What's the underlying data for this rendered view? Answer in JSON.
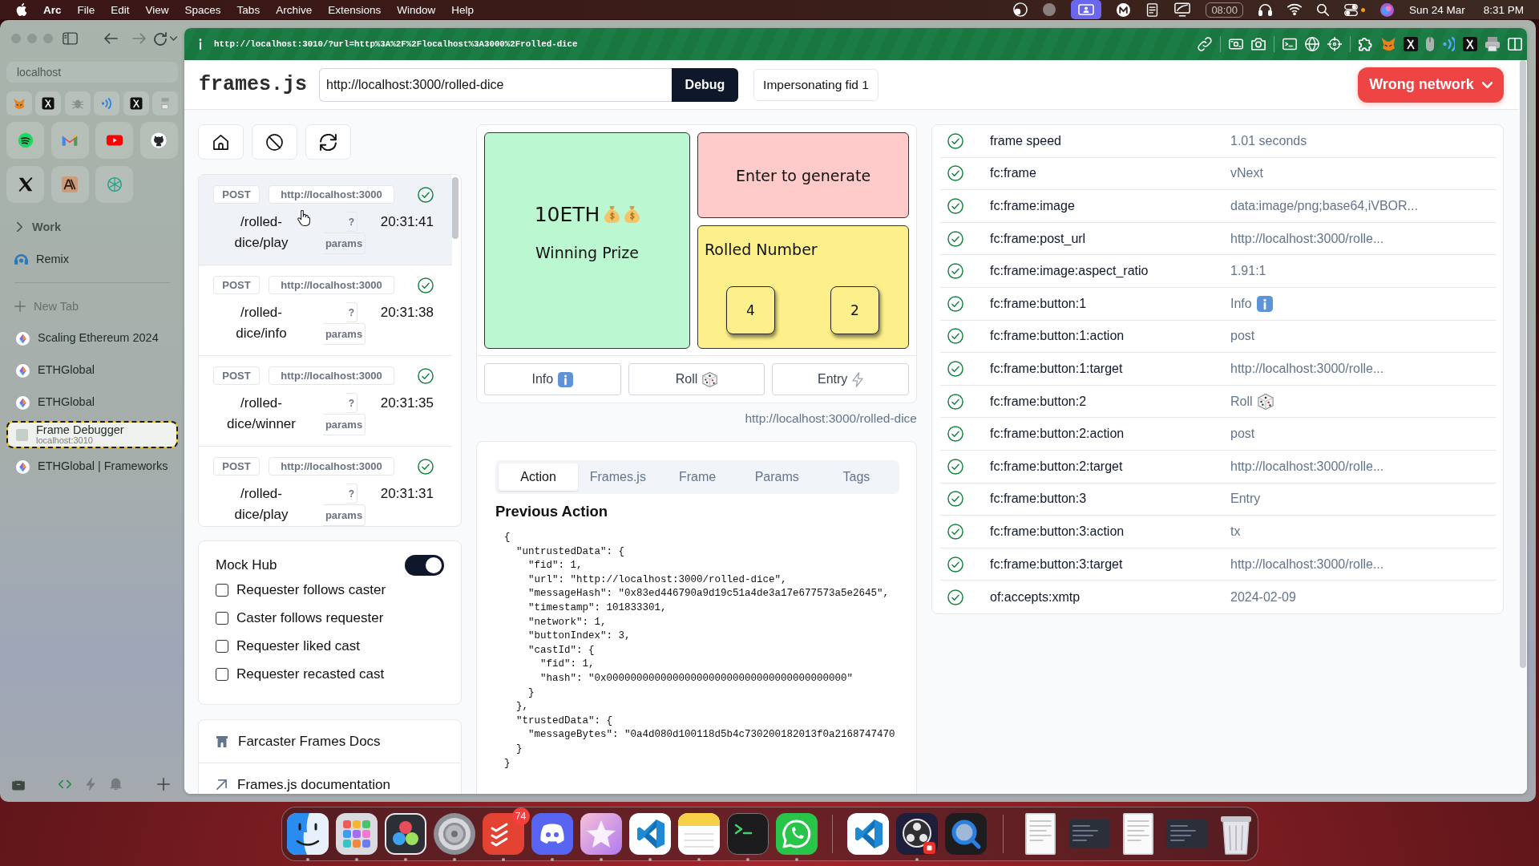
{
  "menu_bar": {
    "app": "Arc",
    "menus": [
      "File",
      "Edit",
      "View",
      "Spaces",
      "Tabs",
      "Archive",
      "Extensions",
      "Window",
      "Help"
    ],
    "timer": "08:00",
    "date": "Sun 24 Mar",
    "time": "8:31 PM"
  },
  "browser": {
    "address": "http://localhost:3010/?url=http%3A%2F%2Flocalhost%3A3000%2Frolled-dice"
  },
  "sidebar": {
    "search": "localhost",
    "folder": {
      "label": "Work",
      "expanded": false
    },
    "pinned_tab": "Remix",
    "new_tab": "New Tab",
    "tabs": [
      {
        "title": "Scaling Ethereum 2024",
        "kind": "page",
        "selected": false
      },
      {
        "title": "ETHGlobal",
        "kind": "page",
        "selected": false
      },
      {
        "title": "ETHGlobal",
        "kind": "page",
        "selected": false
      },
      {
        "title": "Frame Debugger",
        "subtitle": "localhost:3010",
        "kind": "local",
        "selected": true
      },
      {
        "title": "ETHGlobal | Frameworks",
        "kind": "page",
        "selected": false
      }
    ]
  },
  "page": {
    "header": {
      "logo": "frames.js",
      "url": "http://localhost:3000/rolled-dice",
      "debug": "Debug",
      "impersonation": "Impersonating fid 1",
      "network": "Wrong network"
    },
    "requests": [
      {
        "method": "POST",
        "host": "http://localhost:3000",
        "path": "/rolled-dice/play",
        "help": "?",
        "params": "params",
        "time": "20:31:41",
        "ok": true,
        "selected": true
      },
      {
        "method": "POST",
        "host": "http://localhost:3000",
        "path": "/rolled-dice/info",
        "help": "?",
        "params": "params",
        "time": "20:31:38",
        "ok": true,
        "selected": false
      },
      {
        "method": "POST",
        "host": "http://localhost:3000",
        "path": "/rolled-dice/winner",
        "help": "?",
        "params": "params",
        "time": "20:31:35",
        "ok": true,
        "selected": false
      },
      {
        "method": "POST",
        "host": "http://localhost:3000",
        "path": "/rolled-dice/play",
        "help": "?",
        "params": "params",
        "time": "20:31:31",
        "ok": true,
        "selected": false
      }
    ],
    "mock_hub": {
      "title": "Mock Hub",
      "on": true,
      "options": [
        {
          "label": "Requester follows caster",
          "checked": false
        },
        {
          "label": "Caster follows requester",
          "checked": false
        },
        {
          "label": "Requester liked cast",
          "checked": false
        },
        {
          "label": "Requester recasted cast",
          "checked": false
        }
      ]
    },
    "links": [
      {
        "label": "Farcaster Frames Docs",
        "kind": "docs"
      },
      {
        "label": "Frames.js documentation",
        "kind": "external"
      }
    ],
    "frame": {
      "prize": "10ETH",
      "prize_label": "Winning Prize",
      "prompt": "Enter to generate",
      "rolled_title": "Rolled Number",
      "dice": [
        "4",
        "2"
      ],
      "buttons": [
        {
          "label": "Info",
          "kind": "info"
        },
        {
          "label": "Roll",
          "kind": "dice"
        },
        {
          "label": "Entry",
          "kind": "bolt"
        }
      ],
      "url": "http://localhost:3000/rolled-dice"
    },
    "inspector": {
      "tabs": [
        {
          "label": "Action",
          "selected": true
        },
        {
          "label": "Frames.js",
          "selected": false
        },
        {
          "label": "Frame",
          "selected": false
        },
        {
          "label": "Params",
          "selected": false
        },
        {
          "label": "Tags",
          "selected": false
        }
      ],
      "title": "Previous Action",
      "code": "{\n  \"untrustedData\": {\n    \"fid\": 1,\n    \"url\": \"http://localhost:3000/rolled-dice\",\n    \"messageHash\": \"0x83ed446790a9d19c51a4de3a17e677573a5e2645\",\n    \"timestamp\": 101833301,\n    \"network\": 1,\n    \"buttonIndex\": 3,\n    \"castId\": {\n      \"fid\": 1,\n      \"hash\": \"0x0000000000000000000000000000000000000000\"\n    }\n  },\n  \"trustedData\": {\n    \"messageBytes\": \"0a4d080d100118d5b4c730200182013f0a2168747470\n  }\n}"
    },
    "properties": [
      {
        "name": "frame speed",
        "value": "1.01 seconds",
        "kind": "text",
        "ok": true
      },
      {
        "name": "fc:frame",
        "value": "vNext",
        "kind": "text",
        "ok": true
      },
      {
        "name": "fc:frame:image",
        "value": "data:image/png;base64,iVBOR...",
        "kind": "text",
        "ok": true
      },
      {
        "name": "fc:frame:post_url",
        "value": "http://localhost:3000/rolle...",
        "kind": "text",
        "ok": true
      },
      {
        "name": "fc:frame:image:aspect_ratio",
        "value": "1.91:1",
        "kind": "text",
        "ok": true
      },
      {
        "name": "fc:frame:button:1",
        "value": "Info",
        "kind": "info",
        "ok": true
      },
      {
        "name": "fc:frame:button:1:action",
        "value": "post",
        "kind": "text",
        "ok": true
      },
      {
        "name": "fc:frame:button:1:target",
        "value": "http://localhost:3000/rolle...",
        "kind": "text",
        "ok": true
      },
      {
        "name": "fc:frame:button:2",
        "value": "Roll",
        "kind": "dice",
        "ok": true
      },
      {
        "name": "fc:frame:button:2:action",
        "value": "post",
        "kind": "text",
        "ok": true
      },
      {
        "name": "fc:frame:button:2:target",
        "value": "http://localhost:3000/rolle...",
        "kind": "text",
        "ok": true
      },
      {
        "name": "fc:frame:button:3",
        "value": "Entry",
        "kind": "text",
        "ok": true
      },
      {
        "name": "fc:frame:button:3:action",
        "value": "tx",
        "kind": "text",
        "ok": true
      },
      {
        "name": "fc:frame:button:3:target",
        "value": "http://localhost:3000/rolle...",
        "kind": "text",
        "ok": true
      },
      {
        "name": "of:accepts:xmtp",
        "value": "2024-02-09",
        "kind": "text",
        "ok": true
      }
    ]
  },
  "dock": {
    "apps": [
      {
        "kind": "finder",
        "running": true
      },
      {
        "kind": "launchpad",
        "running": true
      },
      {
        "kind": "resolve",
        "running": true
      },
      {
        "kind": "settings",
        "running": true
      },
      {
        "kind": "todoist",
        "running": true,
        "badge": "74"
      },
      {
        "kind": "discord",
        "running": true
      },
      {
        "kind": "gallery",
        "running": true
      },
      {
        "kind": "vscode",
        "running": true
      },
      {
        "kind": "notes",
        "running": true
      },
      {
        "kind": "terminal",
        "running": true
      },
      {
        "kind": "whatsapp",
        "running": true
      }
    ],
    "recent": [
      {
        "kind": "vscode",
        "running": false
      },
      {
        "kind": "obs",
        "running": true
      },
      {
        "kind": "quicktime",
        "running": false
      }
    ],
    "stack": [
      {
        "kind": "document"
      },
      {
        "kind": "screenshot"
      },
      {
        "kind": "document"
      },
      {
        "kind": "screenshot"
      },
      {
        "kind": "trash"
      }
    ]
  }
}
